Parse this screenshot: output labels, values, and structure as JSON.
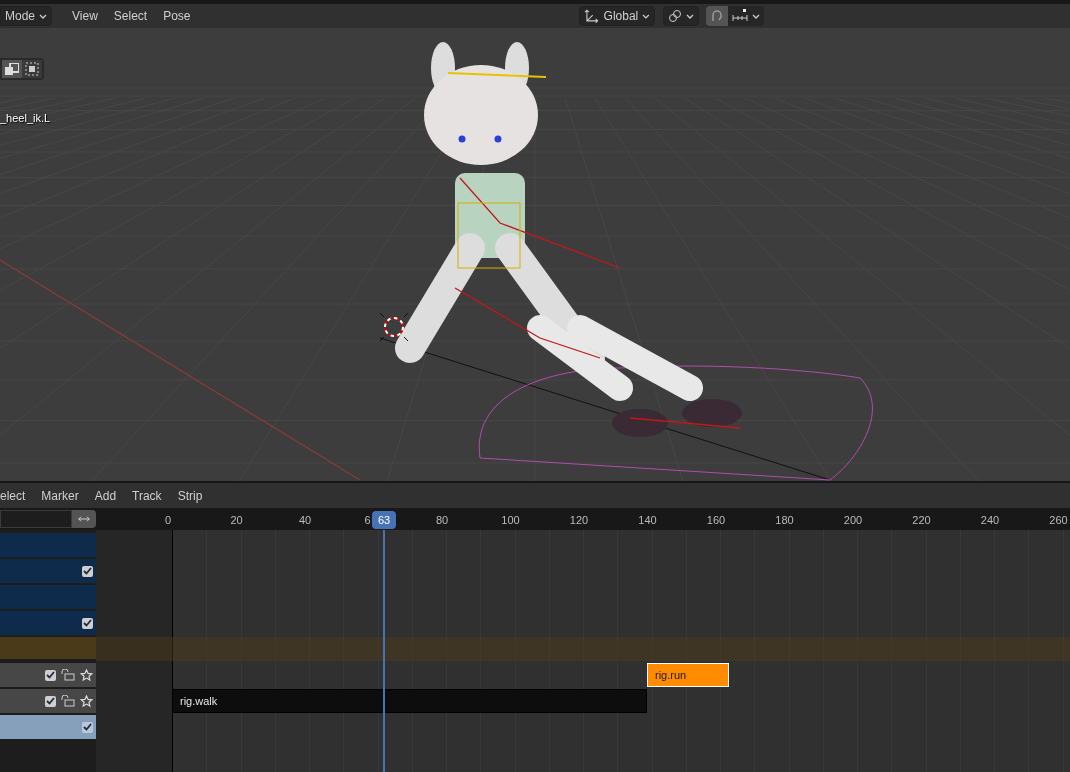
{
  "header": {
    "mode": "Mode",
    "menus": [
      "View",
      "Select",
      "Pose"
    ],
    "orientation": "Global",
    "snap_on": true
  },
  "viewport": {
    "bone_label": "_heel_ik.L"
  },
  "nla": {
    "menus": [
      "elect",
      "Marker",
      "Add",
      "Track",
      "Strip"
    ],
    "ruler_labels": [
      "0",
      "20",
      "40",
      "6",
      "80",
      "100",
      "120",
      "140",
      "160",
      "180",
      "200",
      "220",
      "240",
      "260"
    ],
    "current_frame": "63",
    "tracks": [
      {
        "kind": "object"
      },
      {
        "kind": "object",
        "checked": true
      },
      {
        "kind": "object"
      },
      {
        "kind": "object",
        "checked": true
      },
      {
        "kind": "action"
      },
      {
        "kind": "track",
        "checked": true,
        "strips": [
          {
            "label": "rig.run",
            "selected": true
          }
        ]
      },
      {
        "kind": "track",
        "checked": true,
        "strips": [
          {
            "label": "rig.walk",
            "selected": false
          }
        ]
      },
      {
        "kind": "active",
        "checked": true
      }
    ]
  }
}
